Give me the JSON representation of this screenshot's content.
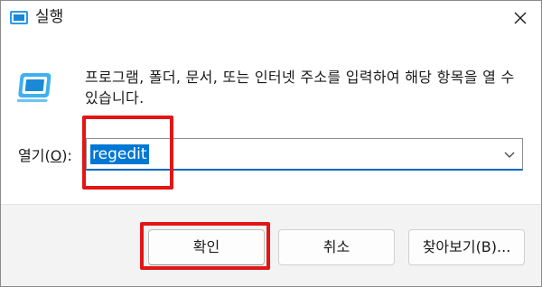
{
  "window": {
    "title": "실행",
    "close_symbol": "✕"
  },
  "description": "프로그램, 폴더, 문서, 또는 인터넷 주소를 입력하여 해당 항목을 열 수 있습니다.",
  "open_field": {
    "label_before": "열기(",
    "label_key": "O",
    "label_after": "):",
    "value": "regedit"
  },
  "buttons": {
    "ok": "확인",
    "cancel": "취소",
    "browse": "찾아보기(B)..."
  },
  "icons": {
    "title_icon": "run-icon",
    "app_icon": "run-icon",
    "close_icon": "close-icon",
    "dropdown_icon": "chevron-down-icon"
  },
  "colors": {
    "accent": "#0078d4",
    "annotation": "#e31515"
  }
}
